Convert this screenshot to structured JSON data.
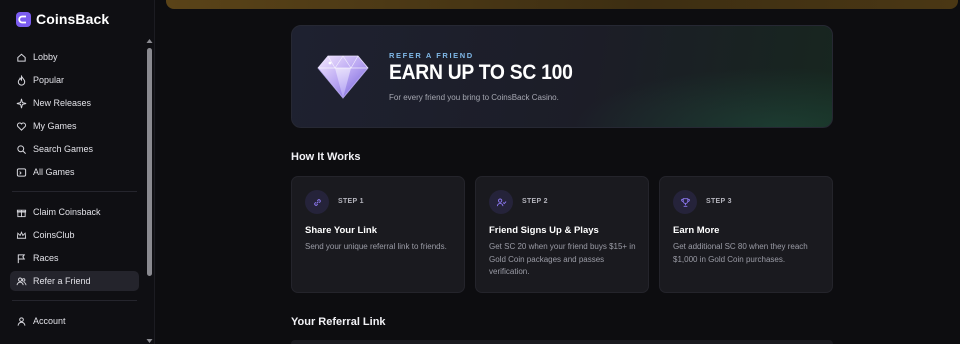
{
  "app": {
    "name": "CoinsBack",
    "brand_color": "#7b5cf0"
  },
  "sidebar": {
    "group1": [
      {
        "label": "Lobby",
        "icon": "home-icon"
      },
      {
        "label": "Popular",
        "icon": "flame-icon"
      },
      {
        "label": "New Releases",
        "icon": "sparkle-icon"
      },
      {
        "label": "My Games",
        "icon": "heart-icon"
      },
      {
        "label": "Search Games",
        "icon": "search-icon"
      },
      {
        "label": "All Games",
        "icon": "grid-icon"
      }
    ],
    "group2": [
      {
        "label": "Claim Coinsback",
        "icon": "gift-icon"
      },
      {
        "label": "CoinsClub",
        "icon": "crown-icon"
      },
      {
        "label": "Races",
        "icon": "flag-icon"
      },
      {
        "label": "Refer a Friend",
        "icon": "users-icon",
        "active": true
      }
    ],
    "group3": [
      {
        "label": "Account",
        "icon": "user-icon"
      }
    ]
  },
  "hero": {
    "kicker": "REFER A FRIEND",
    "title": "EARN UP TO SC 100",
    "subtitle": "For every friend you bring to CoinsBack Casino.",
    "icon": "diamond-icon"
  },
  "how_it_works": {
    "title": "How It Works",
    "steps": [
      {
        "step": "STEP 1",
        "title": "Share Your Link",
        "desc": "Send your unique referral link to friends.",
        "icon": "link-icon"
      },
      {
        "step": "STEP 2",
        "title": "Friend Signs Up & Plays",
        "desc": "Get SC 20 when your friend buys $15+ in Gold Coin packages and passes verification.",
        "icon": "user-check-icon"
      },
      {
        "step": "STEP 3",
        "title": "Earn More",
        "desc": "Get additional SC 80 when they reach $1,000 in Gold Coin purchases.",
        "icon": "trophy-icon"
      }
    ]
  },
  "referral_link": {
    "title": "Your Referral Link"
  }
}
